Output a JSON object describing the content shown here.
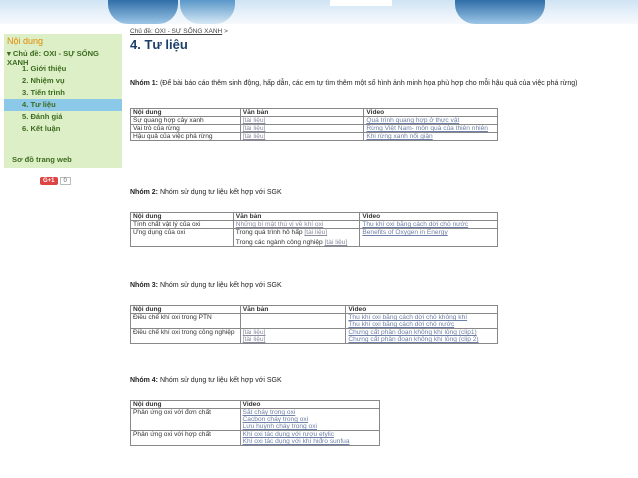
{
  "sidebar": {
    "heading": "Nội dung",
    "topic": "▾ Chủ đề: OXI - SỰ SỐNG XANH",
    "items": [
      "1. Giới thiệu",
      "2. Nhiệm vụ",
      "3. Tiến trình",
      "4. Tư liệu",
      "5. Đánh giá",
      "6. Kết luận"
    ],
    "active_index": 3,
    "sitemap": "Sơ đồ trang web",
    "gplus": "G+1",
    "gplus_count": "0"
  },
  "breadcrumb": {
    "link": "Chủ đề: OXI - SỰ SỐNG XANH",
    "sep": ">"
  },
  "page_title": "4. Tư liệu",
  "group1": {
    "label": "Nhóm 1:",
    "text": "(Để bài báo cáo thêm sinh động, hấp dẫn, các em tự tìm thêm một số hình ảnh minh họa phù hợp cho mỗi hậu quả của việc phá rừng)",
    "headers": [
      "Nội dung",
      "Văn bản",
      "Video"
    ],
    "rows": [
      {
        "content": "Sự quang hợp cây xanh",
        "doc": "[tài liệu]",
        "video": "Quá trình quang hợp ở thực vật"
      },
      {
        "content": "Vai trò của rừng",
        "doc": "[tài liệu]",
        "video": "Rừng Việt Nam- môn quà của thiên nhiên"
      },
      {
        "content": "Hậu quả của việc phá rừng",
        "doc": "[tài liệu]",
        "video": "Khi rừng xanh nổi giận"
      }
    ]
  },
  "group2": {
    "label": "Nhóm 2:",
    "text": "Nhóm sử dụng tư liệu kết hợp với SGK",
    "headers": [
      "Nội dung",
      "Văn bản",
      "Video"
    ],
    "row1": {
      "content": "Tính chất vật lý của oxi",
      "doc": "Những bí mật thú vị về khí oxi",
      "video": "Thu khí oxi bằng cách dời chỗ nước"
    },
    "row2": {
      "content": "Ứng dụng của oxi",
      "doc1_text": "Trong quá trình hô hấp",
      "doc1_link": "[tài liệu]",
      "doc2_text": "Trong các ngành công nghiệp",
      "doc2_link": "[tài liệu]",
      "video": "Benefits of Oxygen in Energy"
    }
  },
  "group3": {
    "label": "Nhóm 3:",
    "text": "Nhóm sử dụng tư liệu kết hợp với SGK",
    "headers": [
      "Nội dung",
      "Văn bản",
      "Video"
    ],
    "row1": {
      "content": "Điều chế khí oxi trong PTN",
      "video1": "Thu khí oxi bằng cách dời chỗ không khí",
      "video2": "Thu khí oxi bằng cách dời chỗ nước"
    },
    "row2": {
      "content": "Điều chế khí oxi trong công nghiệp",
      "doc1": "[tài liệu]",
      "doc2": "[tài liệu]",
      "video1": "Chưng cất phân đoạn không khí lỏng (clip1)",
      "video2": "Chưng cất phân đoạn không khí lỏng (clip 2)"
    }
  },
  "group4": {
    "label": "Nhóm 4:",
    "text": "Nhóm sử dụng tư liệu kết hợp với SGK",
    "headers": [
      "Nội dung",
      "Video"
    ],
    "row1": {
      "content": "Phản ứng oxi với đơn chất",
      "videos": [
        "Sắt cháy trong oxi",
        "Cacbon cháy trong oxi",
        "Lưu huỳnh cháy trong oxi"
      ]
    },
    "row2": {
      "content": "Phản ứng oxi với hợp chất",
      "videos": [
        "Khí oxi tác dụng với rượu etylic",
        "Khí oxi tác dụng với khí hiđro sunfua"
      ]
    }
  }
}
